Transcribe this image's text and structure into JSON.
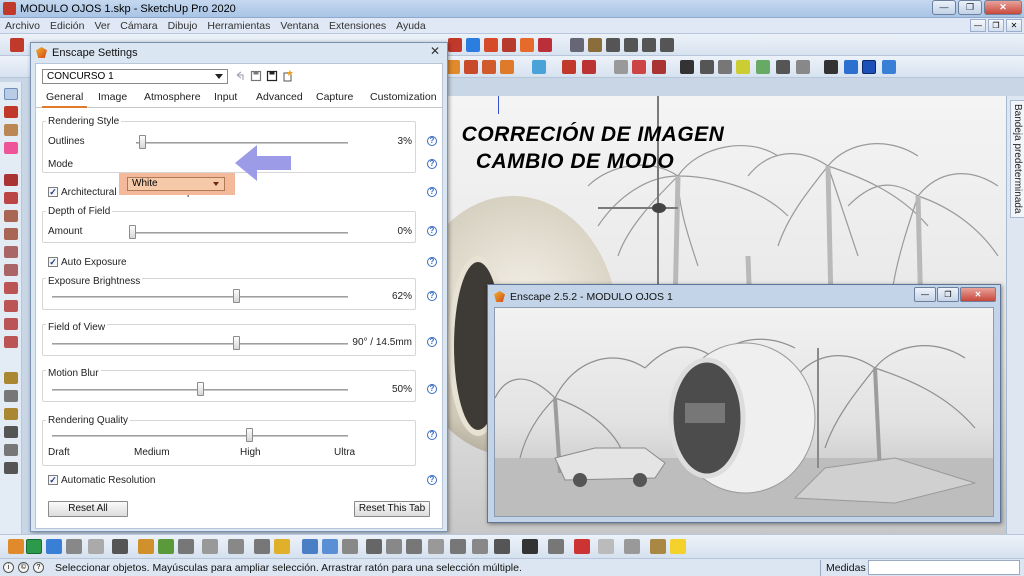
{
  "window": {
    "title": "MODULO OJOS 1.skp - SketchUp Pro 2020",
    "buttons": {
      "minimize": "—",
      "restore": "❐",
      "close": "✕"
    }
  },
  "menu": [
    "Archivo",
    "Edición",
    "Ver",
    "Cámara",
    "Dibujo",
    "Herramientas",
    "Ventana",
    "Extensiones",
    "Ayuda"
  ],
  "overlay": {
    "line1": "CORRECIÓN DE IMAGEN",
    "line2": "CAMBIO DE MODO"
  },
  "tray": {
    "label": "Bandeja predeterminada"
  },
  "settings": {
    "title": "Enscape Settings",
    "preset": "CONCURSO 1",
    "tabs": [
      "General",
      "Image",
      "Atmosphere",
      "Input",
      "Advanced",
      "Capture",
      "Customization"
    ],
    "active_tab": "General",
    "rendering_style": {
      "title": "Rendering Style",
      "outlines_label": "Outlines",
      "outlines_value": "3%",
      "outlines_level": 0.03,
      "mode_label": "Mode",
      "mode_value": "White"
    },
    "two_point": {
      "label": "Architectural Two-Point Perspective",
      "checked": true
    },
    "depth_of_field": {
      "title": "Depth of Field",
      "amount_label": "Amount",
      "amount_value": "0%",
      "amount_level": 0.0
    },
    "auto_exposure": {
      "label": "Auto Exposure",
      "checked": true
    },
    "exposure": {
      "title": "Exposure Brightness",
      "value": "62%",
      "level": 0.62
    },
    "fov": {
      "title": "Field of View",
      "value": "90° / 14.5mm",
      "level": 0.62
    },
    "motion_blur": {
      "title": "Motion Blur",
      "value": "50%",
      "level": 0.5
    },
    "quality": {
      "title": "Rendering Quality",
      "levels": [
        "Draft",
        "Medium",
        "High",
        "Ultra"
      ],
      "selected": "High",
      "level": 0.666
    },
    "auto_resolution": {
      "label": "Automatic Resolution",
      "checked": true
    },
    "reset_all": "Reset All",
    "reset_tab": "Reset This Tab",
    "help_glyph": "?",
    "check_glyph": "✓",
    "close_glyph": "✕"
  },
  "render_window": {
    "title": "Enscape 2.5.2 - MODULO OJOS 1",
    "buttons": {
      "minimize": "—",
      "restore": "❐",
      "close": "✕"
    }
  },
  "status": {
    "text": "Seleccionar objetos. Mayúsculas para ampliar selección. Arrastrar ratón para una selección múltiple.",
    "measures_label": "Medidas",
    "icons": [
      "i",
      "©",
      "?"
    ]
  },
  "colors": {
    "accent_tab": "#e07b2b",
    "highlight": "#f4b99a",
    "arrow": "#9b9be8"
  }
}
